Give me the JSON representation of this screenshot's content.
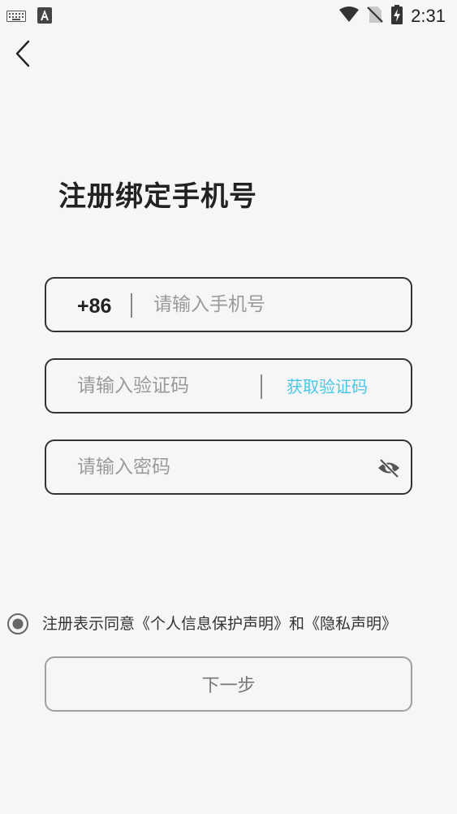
{
  "status_bar": {
    "time": "2:31",
    "left_icons": [
      "keyboard-icon",
      "a-badge-icon"
    ],
    "right_icons": [
      "wifi-icon",
      "no-sim-icon",
      "battery-charging-icon"
    ]
  },
  "header": {
    "back_icon": "chevron-left-icon"
  },
  "title": "注册绑定手机号",
  "phone": {
    "country_code": "+86",
    "placeholder": "请输入手机号",
    "value": ""
  },
  "code": {
    "placeholder": "请输入验证码",
    "value": "",
    "button_label": "获取验证码"
  },
  "password": {
    "placeholder": "请输入密码",
    "value": "",
    "toggle_icon": "eye-off-icon"
  },
  "agreement": {
    "prefix": "注册表示同意",
    "privacy_statement": "《个人信息保护声明》",
    "conjunction": "和",
    "privacy_policy": "《隐私声明》",
    "checked": true
  },
  "next_button": "下一步",
  "colors": {
    "background": "#f6f6f6",
    "accent": "#47c8e6",
    "text": "#222222",
    "placeholder": "#9a9a9a"
  }
}
